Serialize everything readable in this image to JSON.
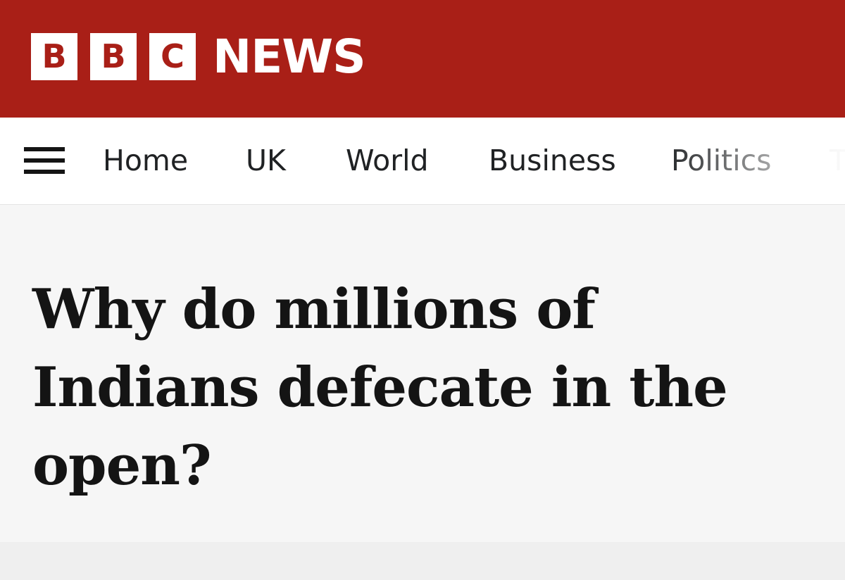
{
  "brand": {
    "letters": [
      "B",
      "B",
      "C"
    ],
    "name": "NEWS",
    "colors": {
      "masthead": "#a91f17",
      "logo_block": "#ffffff",
      "text_dark": "#141414"
    }
  },
  "nav": {
    "menu_icon": "hamburger-menu-icon",
    "items": [
      {
        "label": "Home"
      },
      {
        "label": "UK"
      },
      {
        "label": "World"
      },
      {
        "label": "Business"
      },
      {
        "label": "Politics"
      },
      {
        "label": "T"
      }
    ]
  },
  "article": {
    "headline": "Why do millions of Indians defecate in the open?"
  }
}
